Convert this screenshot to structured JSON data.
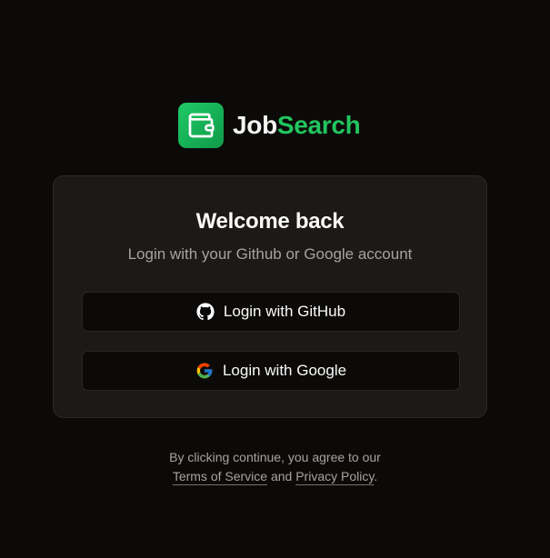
{
  "brand": {
    "icon": "wallet-icon",
    "name_part1": "Job",
    "name_part2": "Search",
    "accent_color": "#22c55e"
  },
  "login_card": {
    "title": "Welcome back",
    "subtitle": "Login with your Github or Google account",
    "buttons": [
      {
        "icon": "github-icon",
        "label": "Login with GitHub"
      },
      {
        "icon": "google-icon",
        "label": "Login with Google"
      }
    ]
  },
  "legal": {
    "line1": "By clicking continue, you agree to our",
    "terms_label": "Terms of Service",
    "and_text": "and",
    "privacy_label": "Privacy Policy",
    "end_punct": "."
  }
}
